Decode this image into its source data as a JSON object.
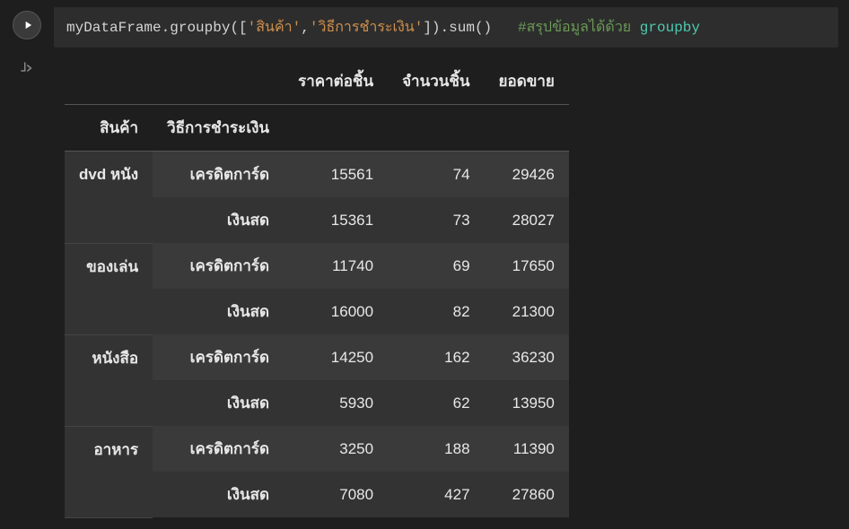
{
  "code": {
    "obj": "myDataFrame",
    "dot1": ".",
    "method1": "groupby",
    "open": "([",
    "str1": "'สินค้า'",
    "comma": ",",
    "str2": "'วิธีการชำระเงิน'",
    "close": "]).",
    "method2": "sum",
    "parens": "()",
    "spaces": "   ",
    "comment_prefix": "#สรุปข้อมูลได้ด้วย ",
    "comment_kw": "groupby"
  },
  "table": {
    "value_headers": [
      "ราคาต่อชิ้น",
      "จำนวนชิ้น",
      "ยอดขาย"
    ],
    "index_headers": [
      "สินค้า",
      "วิธีการชำระเงิน"
    ],
    "groups": [
      {
        "product": "dvd หนัง",
        "rows": [
          {
            "payment": "เครดิตการ์ด",
            "values": [
              "15561",
              "74",
              "29426"
            ]
          },
          {
            "payment": "เงินสด",
            "values": [
              "15361",
              "73",
              "28027"
            ]
          }
        ]
      },
      {
        "product": "ของเล่น",
        "rows": [
          {
            "payment": "เครดิตการ์ด",
            "values": [
              "11740",
              "69",
              "17650"
            ]
          },
          {
            "payment": "เงินสด",
            "values": [
              "16000",
              "82",
              "21300"
            ]
          }
        ]
      },
      {
        "product": "หนังสือ",
        "rows": [
          {
            "payment": "เครดิตการ์ด",
            "values": [
              "14250",
              "162",
              "36230"
            ]
          },
          {
            "payment": "เงินสด",
            "values": [
              "5930",
              "62",
              "13950"
            ]
          }
        ]
      },
      {
        "product": "อาหาร",
        "rows": [
          {
            "payment": "เครดิตการ์ด",
            "values": [
              "3250",
              "188",
              "11390"
            ]
          },
          {
            "payment": "เงินสด",
            "values": [
              "7080",
              "427",
              "27860"
            ]
          }
        ]
      }
    ]
  }
}
